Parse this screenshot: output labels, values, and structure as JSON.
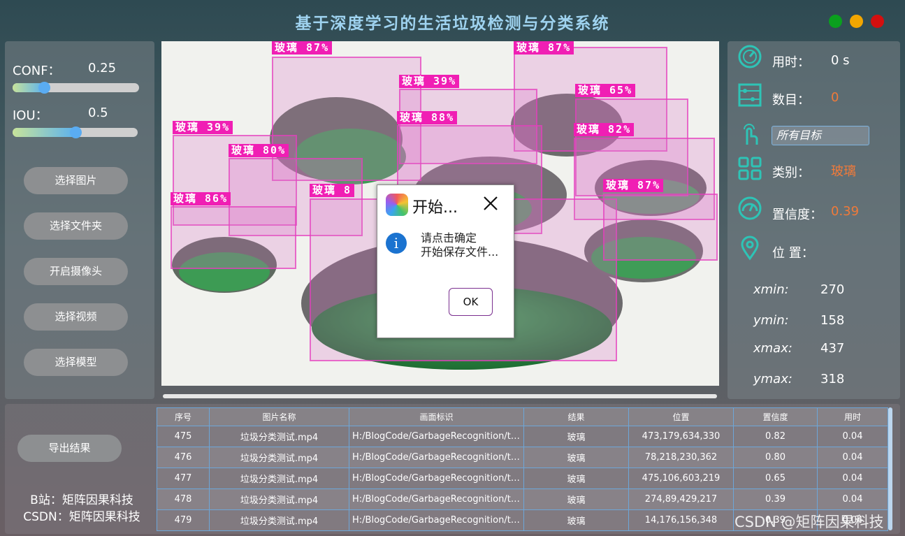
{
  "title": "基于深度学习的生活垃圾检测与分类系统",
  "colors": {
    "accent": "#9fd3f0",
    "value_orange": "#f07a3a",
    "detection": "#f01fb4"
  },
  "params": {
    "conf": {
      "label": "CONF：",
      "value": "0.25",
      "level": 0.25
    },
    "iou": {
      "label": "IOU：",
      "value": "0.5",
      "level": 0.5
    }
  },
  "buttons": [
    "选择图片",
    "选择文件夹",
    "开启摄像头",
    "选择视频",
    "选择模型"
  ],
  "export_button": "导出结果",
  "credits": [
    "B站：矩阵因果科技",
    "CSDN：矩阵因果科技"
  ],
  "detections": [
    {
      "label": "玻璃 87%"
    },
    {
      "label": "玻璃 87%"
    },
    {
      "label": "玻璃 39%"
    },
    {
      "label": "玻璃 65%"
    },
    {
      "label": "玻璃 88%"
    },
    {
      "label": "玻璃 82%"
    },
    {
      "label": "玻璃 39%"
    },
    {
      "label": "玻璃 80%"
    },
    {
      "label": "玻璃 8"
    },
    {
      "label": "玻璃 87%"
    },
    {
      "label": "玻璃 86%"
    }
  ],
  "dialog": {
    "title": "开始...",
    "message_line1": "请点击确定",
    "message_line2": "开始保存文件...",
    "ok": "OK"
  },
  "info": {
    "time_label": "用时：",
    "time_value": "0 s",
    "count_label": "数目：",
    "count_value": "0",
    "filter_value": "所有目标",
    "class_label": "类别：",
    "class_value": "玻璃",
    "conf_label": "置信度：",
    "conf_value": "0.39",
    "position_label": "位 置：",
    "xmin_label": "xmin:",
    "xmin_value": "270",
    "ymin_label": "ymin:",
    "ymin_value": "158",
    "xmax_label": "xmax:",
    "xmax_value": "437",
    "ymax_label": "ymax:",
    "ymax_value": "318"
  },
  "table": {
    "headers": [
      "序号",
      "图片名称",
      "画面标识",
      "结果",
      "位置",
      "置信度",
      "用时"
    ],
    "rows": [
      [
        "475",
        "垃圾分类测试.mp4",
        "H:/BlogCode/GarbageRecognition/te...",
        "玻璃",
        "473,179,634,330",
        "0.82",
        "0.04"
      ],
      [
        "476",
        "垃圾分类测试.mp4",
        "H:/BlogCode/GarbageRecognition/te...",
        "玻璃",
        "78,218,230,362",
        "0.80",
        "0.04"
      ],
      [
        "477",
        "垃圾分类测试.mp4",
        "H:/BlogCode/GarbageRecognition/te...",
        "玻璃",
        "475,106,603,219",
        "0.65",
        "0.04"
      ],
      [
        "478",
        "垃圾分类测试.mp4",
        "H:/BlogCode/GarbageRecognition/te...",
        "玻璃",
        "274,89,429,217",
        "0.39",
        "0.04"
      ],
      [
        "479",
        "垃圾分类测试.mp4",
        "H:/BlogCode/GarbageRecognition/te...",
        "玻璃",
        "14,176,156,348",
        "0.39",
        "0.04"
      ]
    ]
  },
  "watermark": "CSDN @矩阵因果科技"
}
